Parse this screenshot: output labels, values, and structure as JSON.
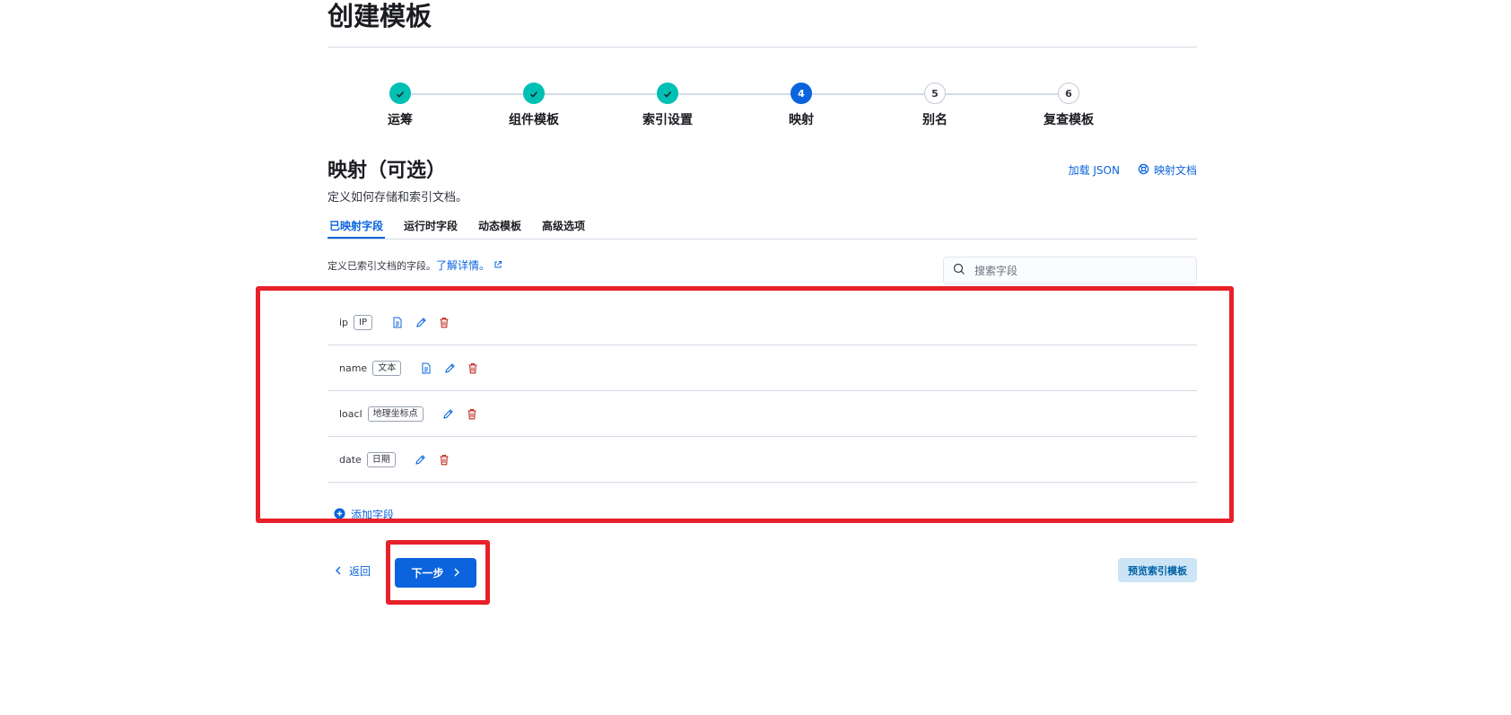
{
  "page": {
    "title": "创建模板"
  },
  "stepper": {
    "steps": [
      {
        "label": "运筹",
        "status": "done",
        "number": ""
      },
      {
        "label": "组件模板",
        "status": "done",
        "number": ""
      },
      {
        "label": "索引设置",
        "status": "done",
        "number": ""
      },
      {
        "label": "映射",
        "status": "current",
        "number": "4"
      },
      {
        "label": "别名",
        "status": "todo",
        "number": "5"
      },
      {
        "label": "复查模板",
        "status": "todo",
        "number": "6"
      }
    ]
  },
  "section": {
    "title": "映射（可选）",
    "description": "定义如何存储和索引文档。",
    "load_json": "加载 JSON",
    "mapping_docs": "映射文档"
  },
  "tabs": [
    {
      "label": "已映射字段",
      "active": true
    },
    {
      "label": "运行时字段",
      "active": false
    },
    {
      "label": "动态模板",
      "active": false
    },
    {
      "label": "高级选项",
      "active": false
    }
  ],
  "fields_panel": {
    "description": "定义已索引文档的字段。",
    "learn_more": "了解详情。",
    "search_placeholder": "搜索字段"
  },
  "fields": [
    {
      "name": "ip",
      "type": "IP",
      "has_doc_icon": true
    },
    {
      "name": "name",
      "type": "文本",
      "has_doc_icon": true
    },
    {
      "name": "loacl",
      "type": "地理坐标点",
      "has_doc_icon": false
    },
    {
      "name": "date",
      "type": "日期",
      "has_doc_icon": false
    }
  ],
  "actions": {
    "add_field": "添加字段",
    "back": "返回",
    "next": "下一步",
    "preview": "预览索引模板"
  },
  "colors": {
    "accent": "#0b64dd",
    "done_step": "#00bfb3",
    "delete": "#bd271e",
    "highlight": "#e8202a"
  }
}
